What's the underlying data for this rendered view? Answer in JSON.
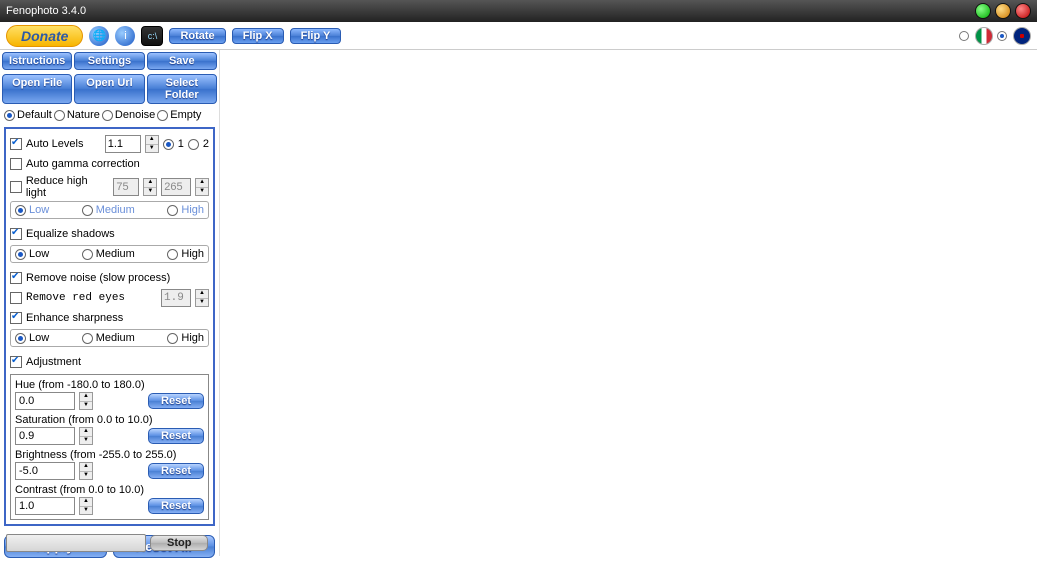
{
  "title": "Fenophoto 3.4.0",
  "toolbar": {
    "donate": "Donate",
    "rotate": "Rotate",
    "flipx": "Flip X",
    "flipy": "Flip Y"
  },
  "tabs1": {
    "instructions": "Istructions",
    "settings": "Settings",
    "save": "Save"
  },
  "tabs2": {
    "open_file": "Open File",
    "open_url": "Open Url",
    "select_folder": "Select Folder"
  },
  "presets": {
    "default": "Default",
    "nature": "Nature",
    "denoise": "Denoise",
    "empty": "Empty"
  },
  "opts": {
    "auto_levels": {
      "label": "Auto Levels",
      "value": "1.1",
      "opt1": "1",
      "opt2": "2"
    },
    "auto_gamma": {
      "label": "Auto gamma correction"
    },
    "reduce_highlight": {
      "label": "Reduce high light",
      "v1": "75",
      "v2": "265"
    },
    "lmh": {
      "low": "Low",
      "medium": "Medium",
      "high": "High"
    },
    "equalize": {
      "label": "Equalize shadows"
    },
    "remove_noise": {
      "label": "Remove noise (slow process)"
    },
    "remove_red_eyes": {
      "label": "Remove red eyes",
      "value": "1.9"
    },
    "enhance_sharpness": {
      "label": "Enhance sharpness"
    },
    "adjustment": {
      "label": "Adjustment"
    }
  },
  "adjust": {
    "hue": {
      "label": "Hue (from -180.0 to 180.0)",
      "value": "0.0"
    },
    "saturation": {
      "label": "Saturation (from 0.0 to 10.0)",
      "value": "0.9"
    },
    "brightness": {
      "label": "Brightness (from -255.0 to 255.0)",
      "value": "-5.0"
    },
    "contrast": {
      "label": "Contrast (from 0.0 to 10.0)",
      "value": "1.0"
    },
    "reset": "Reset"
  },
  "buttons": {
    "apply": "Apply",
    "reset_all": "Reset All",
    "stop": "Stop"
  }
}
